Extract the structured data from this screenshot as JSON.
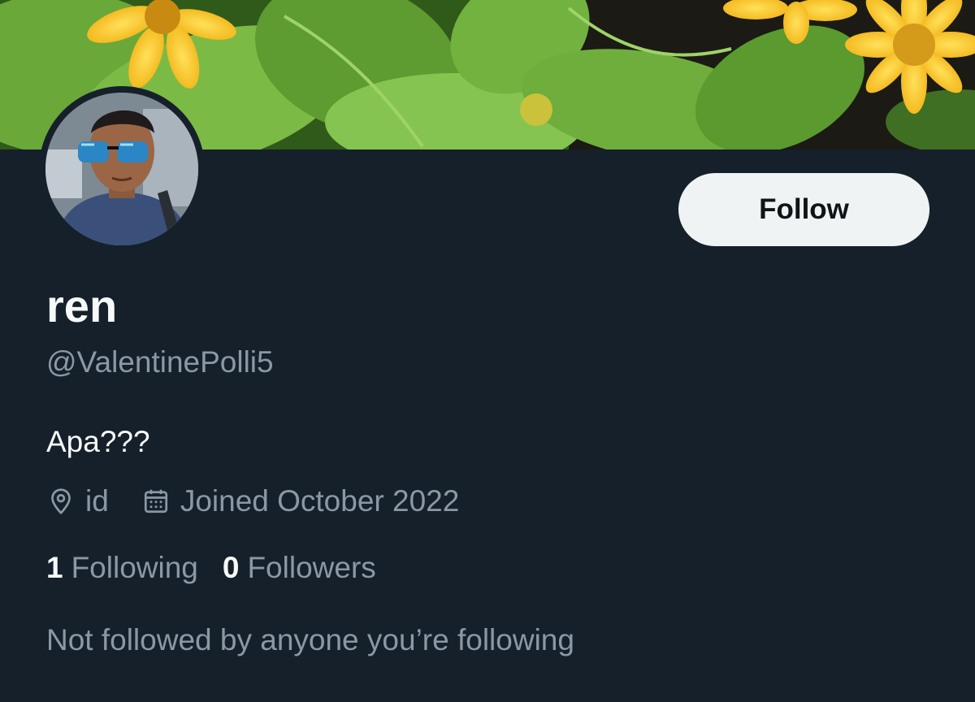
{
  "profile": {
    "display_name": "ren",
    "handle": "@ValentinePolli5",
    "bio": "Apa???",
    "location": "id",
    "joined": "Joined October 2022",
    "following_count": "1",
    "following_label": "Following",
    "followers_count": "0",
    "followers_label": "Followers",
    "followed_by_note": "Not followed by anyone you’re following"
  },
  "actions": {
    "follow_label": "Follow"
  },
  "icons": {
    "location": "location-pin-icon",
    "joined": "calendar-icon"
  },
  "colors": {
    "background": "#15202b",
    "primary_text": "#f7f9f9",
    "secondary_text": "#8b98a5",
    "button_background": "#eff3f4",
    "button_text": "#0f1419"
  }
}
